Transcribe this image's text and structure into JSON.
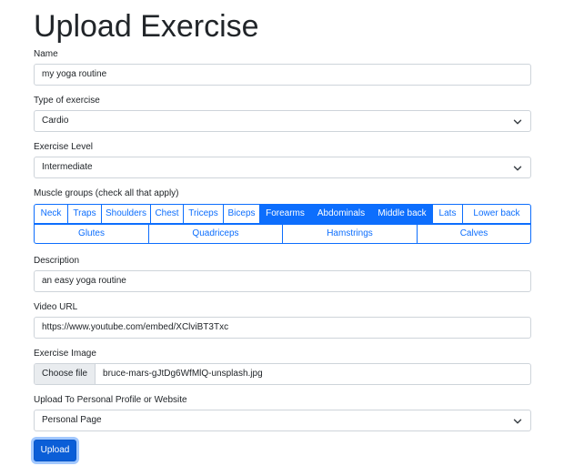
{
  "page": {
    "title": "Upload Exercise"
  },
  "form": {
    "name": {
      "label": "Name",
      "value": "my yoga routine"
    },
    "type": {
      "label": "Type of exercise",
      "value": "Cardio"
    },
    "level": {
      "label": "Exercise Level",
      "value": "Intermediate"
    },
    "muscles": {
      "label": "Muscle groups (check all that apply)",
      "row1": [
        {
          "label": "Neck",
          "selected": false
        },
        {
          "label": "Traps",
          "selected": false
        },
        {
          "label": "Shoulders",
          "selected": false
        },
        {
          "label": "Chest",
          "selected": false
        },
        {
          "label": "Triceps",
          "selected": false
        },
        {
          "label": "Biceps",
          "selected": false
        },
        {
          "label": "Forearms",
          "selected": true
        },
        {
          "label": "Abdominals",
          "selected": true
        },
        {
          "label": "Middle back",
          "selected": true
        },
        {
          "label": "Lats",
          "selected": false
        },
        {
          "label": "Lower back",
          "selected": false
        }
      ],
      "row2": [
        {
          "label": "Glutes",
          "selected": false
        },
        {
          "label": "Quadriceps",
          "selected": false
        },
        {
          "label": "Hamstrings",
          "selected": false
        },
        {
          "label": "Calves",
          "selected": false
        }
      ]
    },
    "description": {
      "label": "Description",
      "value": "an easy yoga routine"
    },
    "video": {
      "label": "Video URL",
      "value": "https://www.youtube.com/embed/XClviBT3Txc"
    },
    "image": {
      "label": "Exercise Image",
      "button_label": "Choose file",
      "file_name": "bruce-mars-gJtDg6WfMlQ-unsplash.jpg"
    },
    "destination": {
      "label": "Upload To Personal Profile or Website",
      "value": "Personal Page"
    },
    "submit_label": "Upload"
  },
  "colors": {
    "primary": "#0d6efd",
    "border": "#ced4da",
    "file_button_bg": "#e9ecef",
    "text": "#212529"
  },
  "icons": {
    "select_arrow": "chevron-down-icon"
  }
}
